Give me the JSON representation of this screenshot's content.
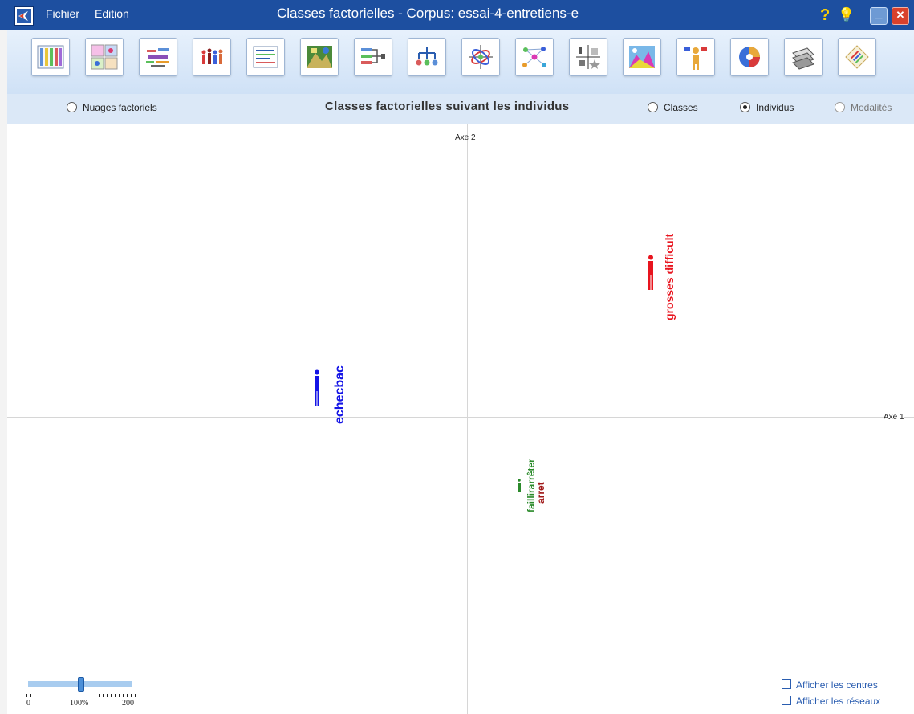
{
  "window": {
    "title": "Classes factorielles - Corpus: essai-4-entretiens-e",
    "menu": [
      "Fichier",
      "Edition"
    ],
    "help_glyph": "?",
    "tip_glyph": "💡",
    "minimize_glyph": "_",
    "close_glyph": "✕"
  },
  "toolbar": {
    "tools": [
      "table-icon",
      "panels-icon",
      "word-cloud-icon",
      "people-icon",
      "text-lines-icon",
      "map-image-icon",
      "flow-diagram-icon",
      "tree-icon",
      "factorial-axes-icon",
      "network-icon",
      "quadrant-icon",
      "landscape-icon",
      "person-flags-icon",
      "radial-chart-icon",
      "cards-icon",
      "palette-icon"
    ]
  },
  "options": {
    "nuages": "Nuages factoriels",
    "heading": "Classes factorielles suivant les individus",
    "classes": "Classes",
    "individus": "Individus",
    "modalites": "Modalités",
    "selected": "individus"
  },
  "chart_data": {
    "type": "scatter",
    "xlabel": "Axe 1",
    "ylabel": "Axe 2",
    "points": [
      {
        "label": "echecbac",
        "x": -0.33,
        "y": 0.12,
        "color": "#1414e6"
      },
      {
        "label": "grosses difficult",
        "x": 0.4,
        "y": 0.5,
        "color": "#e8141e"
      },
      {
        "label": "faillirarrêter",
        "x": 0.12,
        "y": -0.24,
        "color": "#2b8a2b"
      },
      {
        "label": "arret",
        "x": 0.15,
        "y": -0.24,
        "color": "#a01818"
      }
    ]
  },
  "zoom": {
    "min_label": "0",
    "value_label": "100%",
    "max_label": "200",
    "value": 100
  },
  "checkboxes": {
    "centres": "Afficher les centres",
    "reseaux": "Afficher les réseaux"
  },
  "colors": {
    "titlebar": "#1d4fa0",
    "accent": "#2a5db0"
  }
}
